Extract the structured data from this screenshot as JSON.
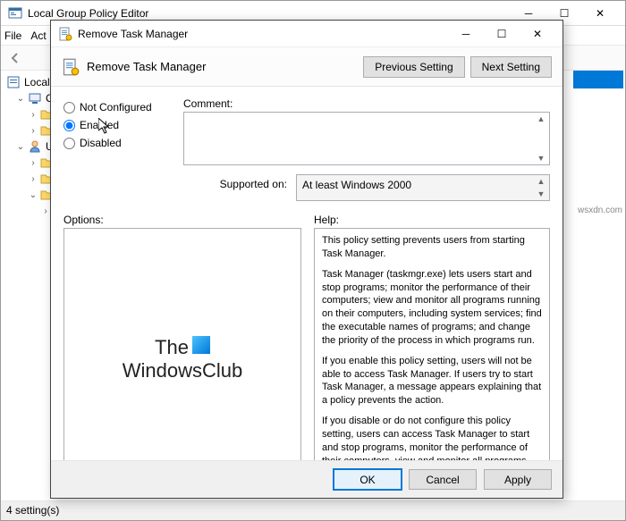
{
  "parent": {
    "title": "Local Group Policy Editor",
    "menu": {
      "file": "File",
      "action": "Act"
    },
    "tree": {
      "root": "Local C",
      "computer": "Cc",
      "user": "Use"
    },
    "status": "4 setting(s)"
  },
  "dialog": {
    "title": "Remove Task Manager",
    "header": "Remove Task Manager",
    "nav": {
      "prev": "Previous Setting",
      "next": "Next Setting"
    },
    "radios": {
      "not_configured": "Not Configured",
      "enabled": "Enabled",
      "disabled": "Disabled"
    },
    "labels": {
      "comment": "Comment:",
      "supported": "Supported on:",
      "options": "Options:",
      "help": "Help:"
    },
    "supported": "At least Windows 2000",
    "help": {
      "p1": "This policy setting prevents users from starting Task Manager.",
      "p2": "Task Manager (taskmgr.exe) lets users start and stop programs; monitor the performance of their computers; view and monitor all programs running on their computers, including system services; find the executable names of programs; and change the priority of the process in which programs run.",
      "p3": "If you enable this policy setting, users will not be able to access Task Manager. If users try to start Task Manager, a message appears explaining that a policy prevents the action.",
      "p4": "If you disable or do not configure this policy setting, users can access Task Manager to  start and stop programs, monitor the performance of their computers, view and monitor all programs running on their computers, including system services, find the executable names of programs, and change the priority of the process in which programs run."
    },
    "buttons": {
      "ok": "OK",
      "cancel": "Cancel",
      "apply": "Apply"
    },
    "logo": {
      "line1": "The",
      "line2": "WindowsClub"
    }
  },
  "watermark": "wsxdn.com"
}
